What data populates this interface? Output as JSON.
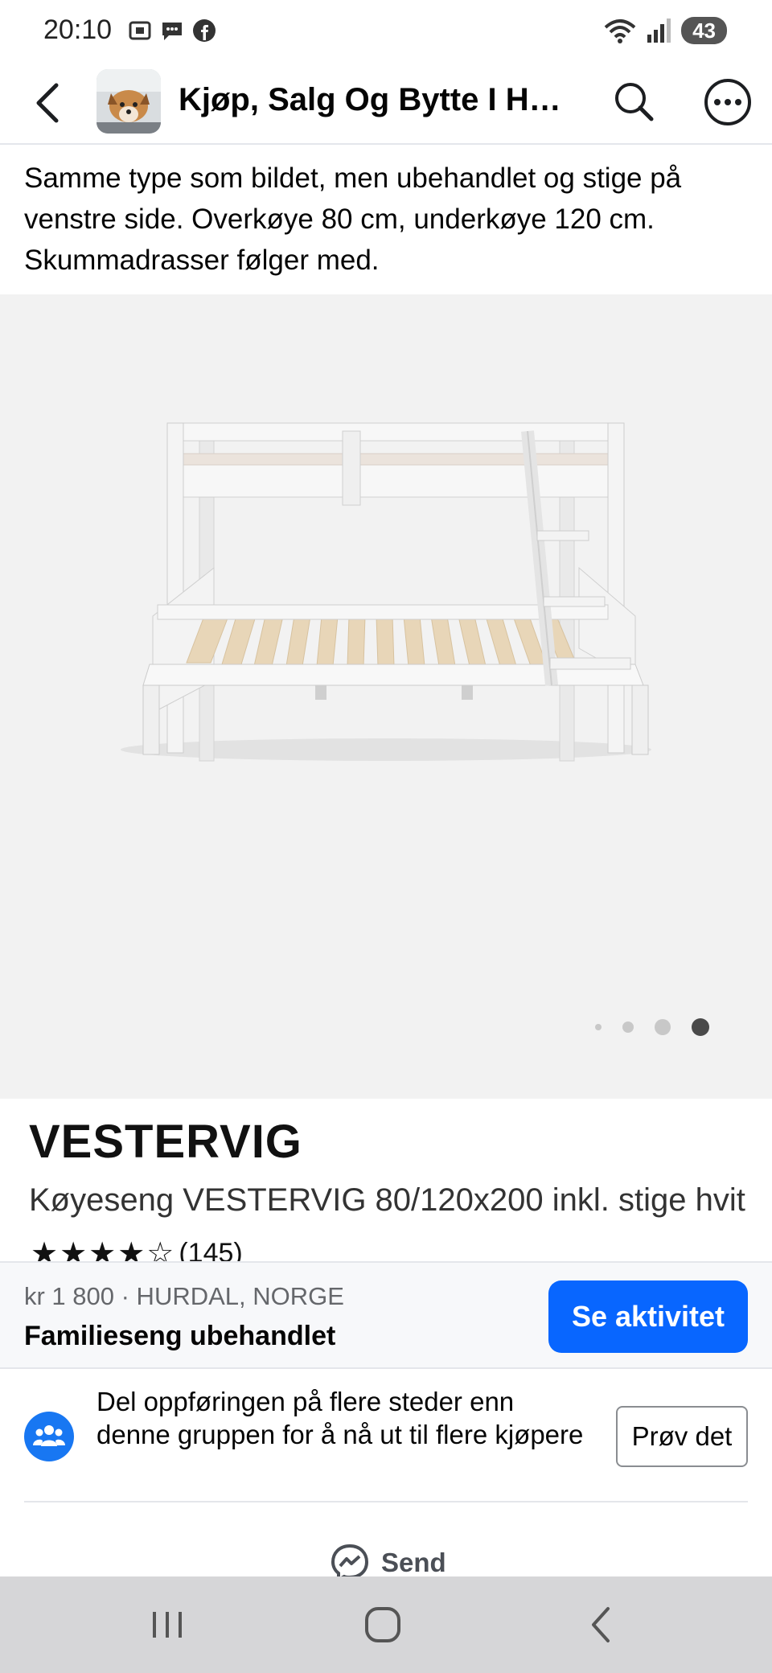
{
  "status_bar": {
    "time": "20:10",
    "wifi_label": "5",
    "battery": "43"
  },
  "header": {
    "title": "Kjøp, Salg Og Bytte I Hurdal"
  },
  "description": "Samme type som bildet, men ubehandlet og stige på venstre side. Overkøye 80 cm, underkøye 120 cm. Skummadrasser følger med.",
  "product_image": {
    "brand": "VESTERVIG",
    "name": "Køyeseng VESTERVIG 80/120x200 inkl. stige hvit",
    "rating_stars": "★★★★☆",
    "rating_count": "(145)",
    "pager": {
      "count": 4,
      "active_index": 3
    }
  },
  "listing": {
    "meta": "kr 1 800 · HURDAL, NORGE",
    "title": "Familieseng ubehandlet",
    "action_label": "Se aktivitet"
  },
  "share_prompt": {
    "text": "Del oppføringen på flere steder enn denne gruppen for å nå ut til flere kjøpere",
    "button_label": "Prøv det"
  },
  "send": {
    "label": "Send"
  },
  "colors": {
    "accent": "#0866ff",
    "share_icon": "#1877f2",
    "nav_bar": "#d6d6d8"
  }
}
